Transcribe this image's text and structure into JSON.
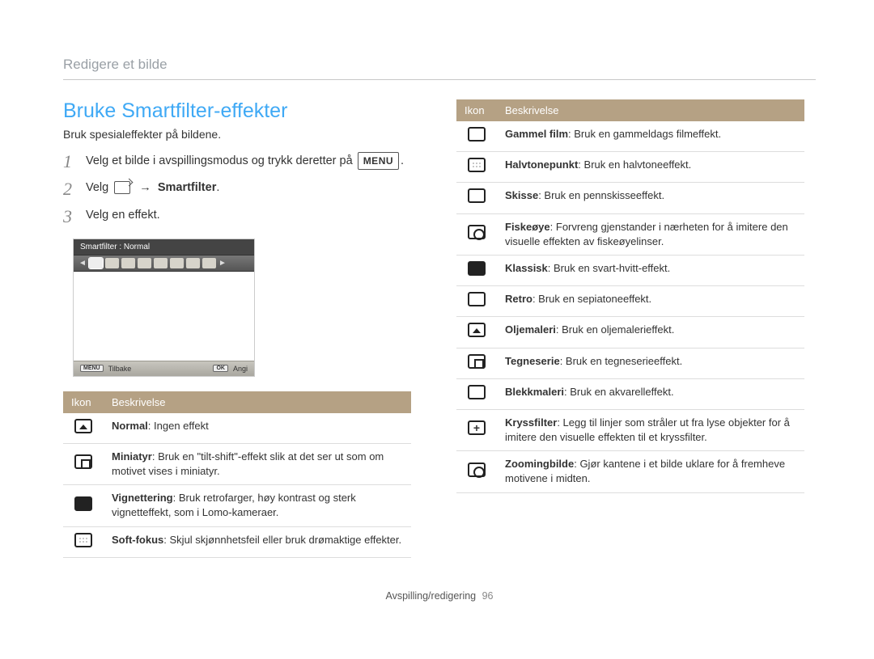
{
  "header": {
    "breadcrumb": "Redigere et bilde"
  },
  "title": "Bruke Smartfilter-effekter",
  "intro": "Bruk spesialeffekter på bildene.",
  "steps": {
    "s1": {
      "num": "1",
      "text_a": "Velg et bilde i avspillingsmodus og trykk deretter på ",
      "menu_label": "MENU",
      "text_b": "."
    },
    "s2": {
      "num": "2",
      "text_a": "Velg ",
      "arrow": " → ",
      "strong": "Smartfilter",
      "text_b": "."
    },
    "s3": {
      "num": "3",
      "text": "Velg en effekt."
    }
  },
  "lcd": {
    "top": "Smartfilter : Normal",
    "back_label": "Tilbake",
    "set_label": "Angi",
    "back_btn": "MENU",
    "set_btn": "OK"
  },
  "table_headers": {
    "icon": "Ikon",
    "desc": "Beskrivelse"
  },
  "left_table": [
    {
      "name": "Normal",
      "desc": ": Ingen effekt"
    },
    {
      "name": "Miniatyr",
      "desc": ": Bruk en \"tilt-shift\"-effekt slik at det ser ut som om motivet vises i miniatyr."
    },
    {
      "name": "Vignettering",
      "desc": ": Bruk retrofarger, høy kontrast og sterk vignetteffekt, som i Lomo-kameraer."
    },
    {
      "name": "Soft-fokus",
      "desc": ": Skjul skjønnhetsfeil eller bruk drømaktige effekter."
    }
  ],
  "right_table": [
    {
      "name": "Gammel film",
      "desc": ": Bruk en gammeldags filmeffekt."
    },
    {
      "name": "Halvtonepunkt",
      "desc": ": Bruk en halvtoneeffekt."
    },
    {
      "name": "Skisse",
      "desc": ": Bruk en pennskisseeffekt."
    },
    {
      "name": "Fiskeøye",
      "desc": ": Forvreng gjenstander i nærheten for å imitere den visuelle effekten av fiskeøyelinser."
    },
    {
      "name": "Klassisk",
      "desc": ": Bruk en svart-hvitt-effekt."
    },
    {
      "name": "Retro",
      "desc": ": Bruk en sepiatoneeffekt."
    },
    {
      "name": "Oljemaleri",
      "desc": ": Bruk en oljemalerieffekt."
    },
    {
      "name": "Tegneserie",
      "desc": ": Bruk en tegneserieeffekt."
    },
    {
      "name": "Blekkmaleri",
      "desc": ": Bruk en akvarelleffekt."
    },
    {
      "name": "Kryssfilter",
      "desc": ": Legg til linjer som stråler ut fra lyse objekter for å imitere den visuelle effekten til et kryssfilter."
    },
    {
      "name": "Zoomingbilde",
      "desc": ": Gjør kantene i et bilde uklare for å fremheve motivene i midten."
    }
  ],
  "footer": {
    "section": "Avspilling/redigering",
    "page": "96"
  }
}
